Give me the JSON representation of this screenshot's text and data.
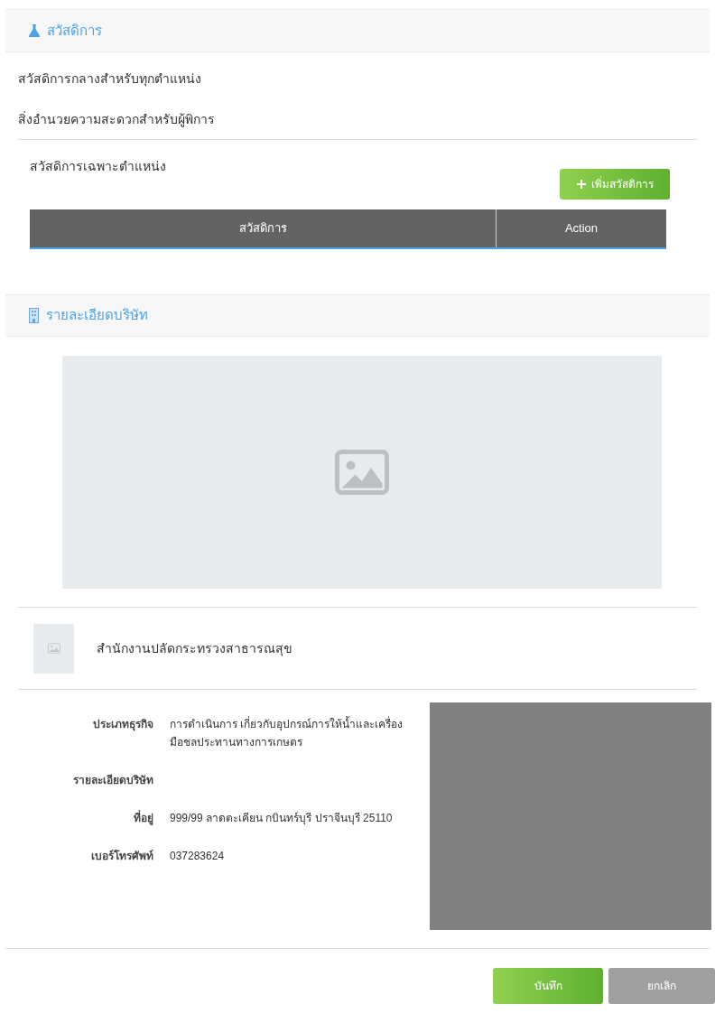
{
  "benefits_section": {
    "title": "สวัสดิการ",
    "general_items": [
      "สวัสดิการกลางสำหรับทุกตำแหน่ง",
      "สิ่งอำนวยความสะดวกสำหรับผู้พิการ"
    ],
    "specific_title": "สวัสดิการเฉพาะตำแหน่ง",
    "add_button": "เพิ่มสวัสดิการ",
    "table": {
      "columns": [
        "สวัสดิการ",
        "Action"
      ]
    }
  },
  "company_section": {
    "title": "รายละเอียดบริษัท",
    "company_name": "สำนักงานปลัดกระทรวงสาธารณสุข",
    "details": [
      {
        "label": "ประเภทธุรกิจ",
        "value": "การดำเนินการ เกี่ยวกับอุปกรณ์การให้น้ำและเครื่องมือชลประทานทางการเกษตร"
      },
      {
        "label": "รายละเอียดบริษัท"
      },
      {
        "label": "ที่อยู่",
        "value": "999/99 ลาดตะเคียน กบินทร์บุรี ปราจีนบุรี 25110"
      },
      {
        "label": "เบอร์โทรศัพท์",
        "value": "037283624"
      }
    ]
  },
  "buttons": [
    {
      "label": "บันทึก",
      "kind": "primary"
    },
    {
      "label": "ยกเลิก",
      "kind": "secondary"
    }
  ]
}
